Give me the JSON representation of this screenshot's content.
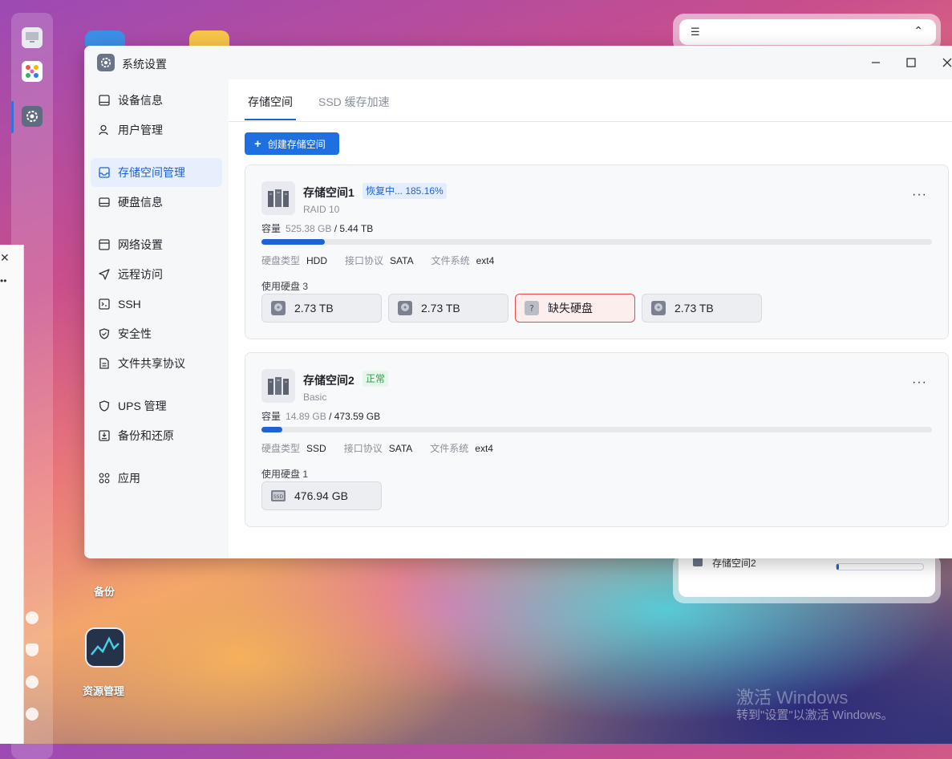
{
  "window": {
    "title": "系统设置",
    "controls": {
      "minimize": "—",
      "maximize": "☐",
      "close": "✕"
    }
  },
  "sidebar": {
    "items": [
      {
        "label": "设备信息",
        "icon": "monitor-icon"
      },
      {
        "label": "用户管理",
        "icon": "user-icon"
      },
      {
        "label": "存储空间管理",
        "icon": "storage-icon",
        "active": true
      },
      {
        "label": "硬盘信息",
        "icon": "harddisk-icon"
      },
      {
        "label": "网络设置",
        "icon": "network-icon"
      },
      {
        "label": "远程访问",
        "icon": "remote-icon"
      },
      {
        "label": "SSH",
        "icon": "terminal-icon"
      },
      {
        "label": "安全性",
        "icon": "shield-icon"
      },
      {
        "label": "文件共享协议",
        "icon": "file-icon"
      },
      {
        "label": "UPS 管理",
        "icon": "ups-icon"
      },
      {
        "label": "备份和还原",
        "icon": "backup-icon"
      },
      {
        "label": "应用",
        "icon": "apps-icon"
      }
    ]
  },
  "tabs": [
    {
      "label": "存储空间",
      "active": true
    },
    {
      "label": "SSD 缓存加速",
      "active": false
    }
  ],
  "create_button": {
    "plus": "+",
    "label": "创建存储空间"
  },
  "pools": [
    {
      "name": "存储空间1",
      "badge": "恢复中... 185.16%",
      "badge_color": "#1e63d6",
      "raid": "RAID 10",
      "capacity_label": "容量",
      "used": "525.38 GB",
      "total": "/ 5.44 TB",
      "usage_fraction": 0.094,
      "disk_type_label": "硬盘类型",
      "disk_type": "HDD",
      "interface_label": "接口协议",
      "interface": "SATA",
      "fs_label": "文件系统",
      "fs": "ext4",
      "disks_label": "使用硬盘 3",
      "disks": [
        {
          "label": "2.73 TB",
          "icon": "hdd-icon"
        },
        {
          "label": "2.73 TB",
          "icon": "hdd-icon"
        },
        {
          "label": "缺失硬盘",
          "icon": "missing-disk-icon",
          "missing": true
        },
        {
          "label": "2.73 TB",
          "icon": "hdd-icon"
        }
      ]
    },
    {
      "name": "存储空间2",
      "badge": "正常",
      "badge_color": "#2f9e4f",
      "raid": "Basic",
      "capacity_label": "容量",
      "used": "14.89 GB",
      "total": "/ 473.59 GB",
      "usage_fraction": 0.031,
      "disk_type_label": "硬盘类型",
      "disk_type": "SSD",
      "interface_label": "接口协议",
      "interface": "SATA",
      "fs_label": "文件系统",
      "fs": "ext4",
      "disks_label": "使用硬盘 1",
      "disks": [
        {
          "label": "476.94 GB",
          "icon": "ssd-icon"
        }
      ]
    }
  ],
  "more_label": "···",
  "desktop": {
    "icons": [
      {
        "label": "备份",
        "icon": "backup-app-icon"
      },
      {
        "label": "资源管理",
        "icon": "monitor-app-icon"
      }
    ],
    "widget_pool_label": "存储空间2",
    "watermark_line1": "激活 Windows",
    "watermark_line2": "转到\"设置\"以激活 Windows。"
  }
}
